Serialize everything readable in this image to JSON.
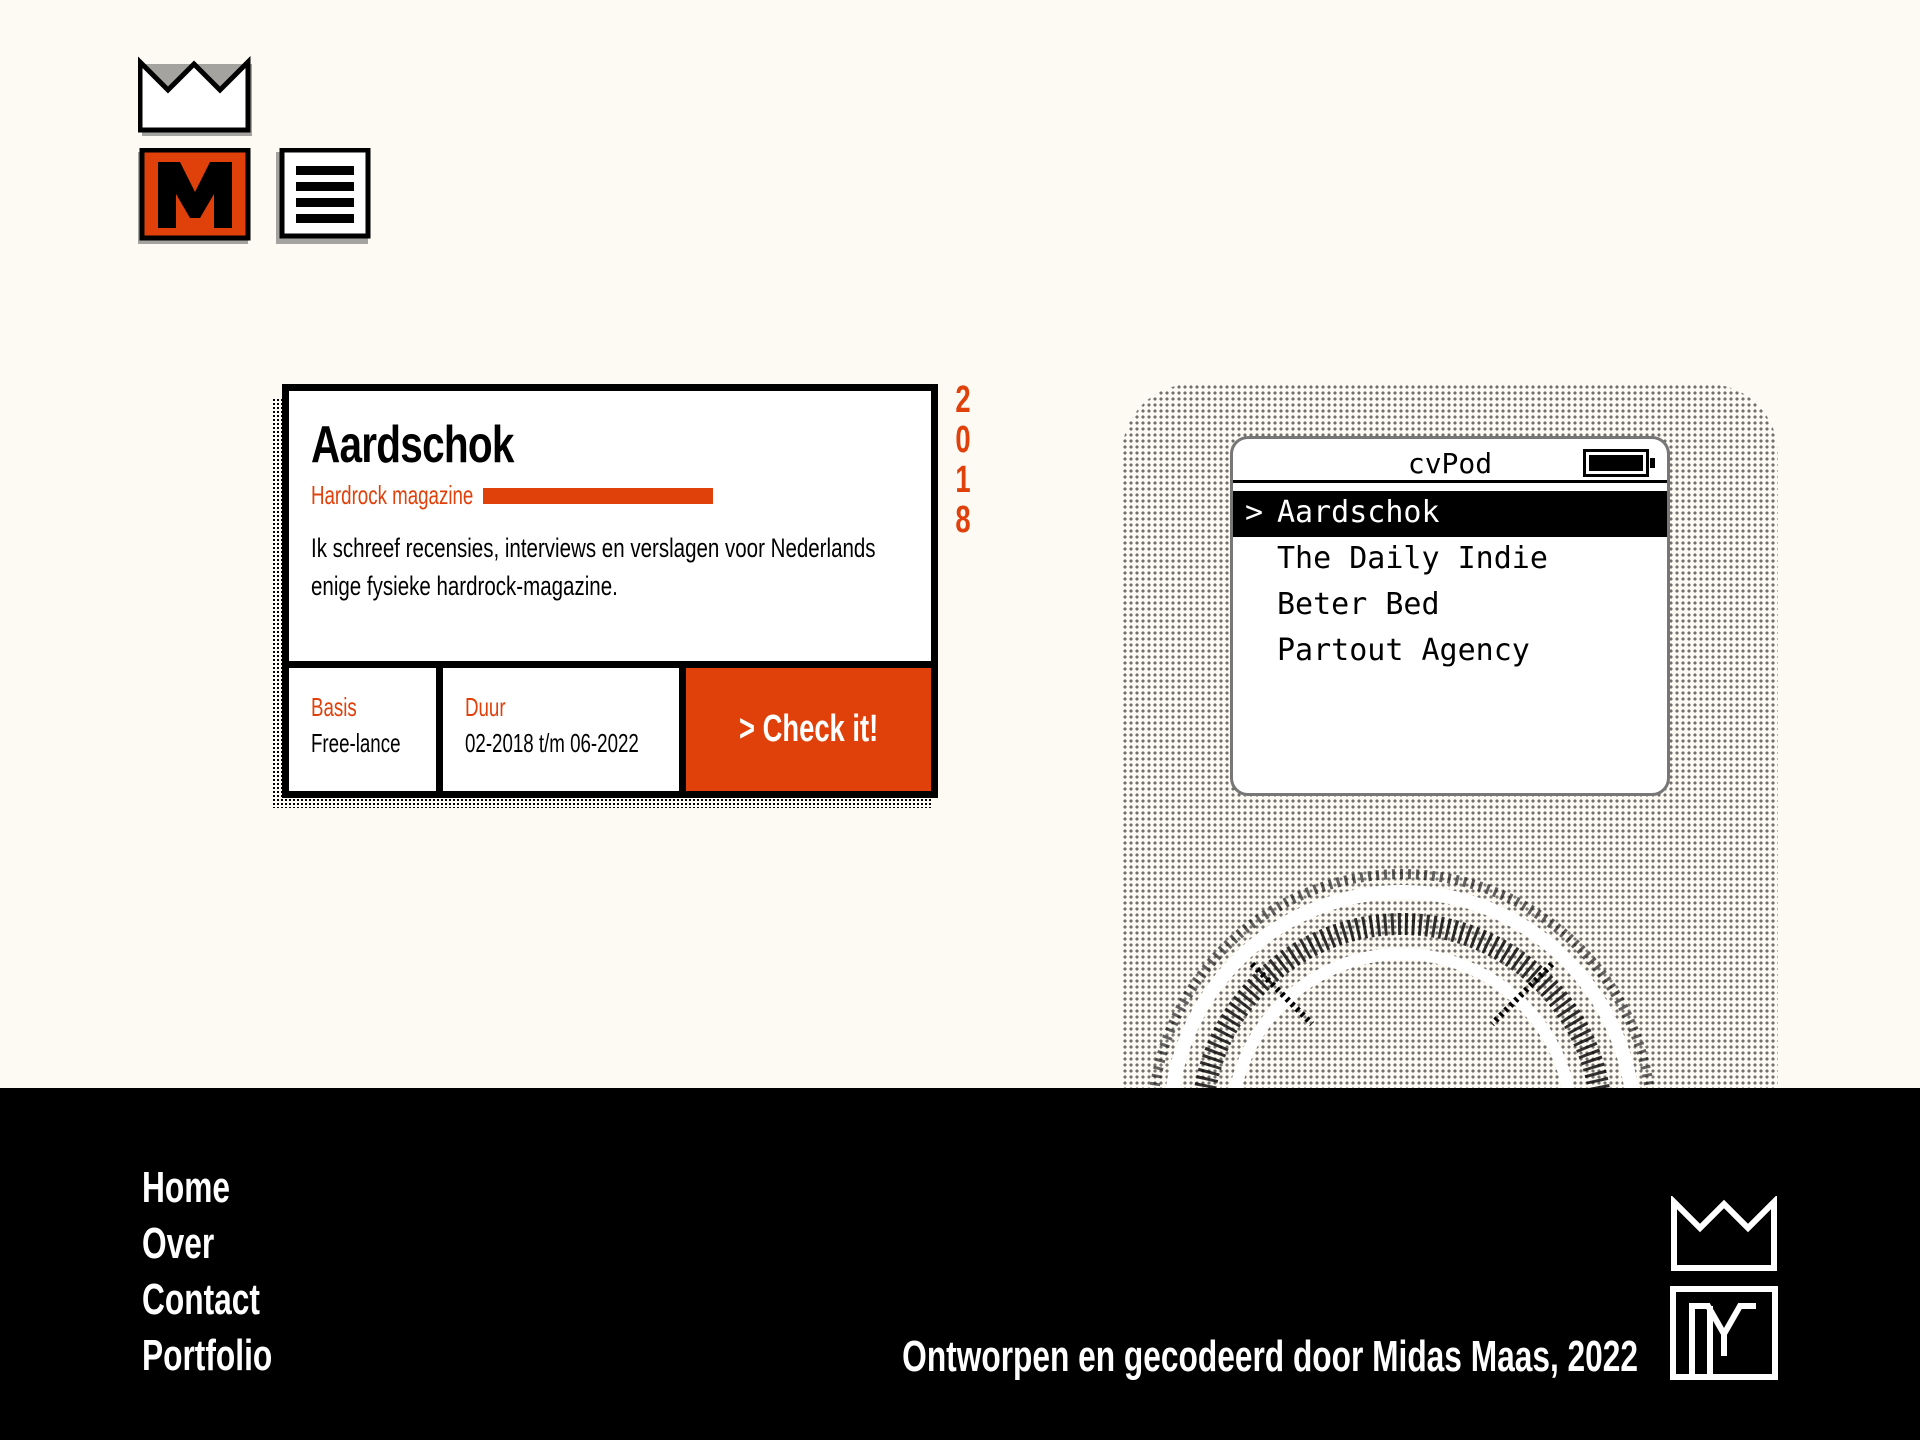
{
  "colors": {
    "accent": "#e0400a",
    "background": "#fdfaf4",
    "ink": "#000000",
    "footer": "#000000"
  },
  "header": {
    "logo_icon": "crown-m-logo-icon",
    "menu_icon": "hamburger-menu-icon"
  },
  "card": {
    "title": "Aardschok",
    "subtitle": "Hardrock magazine",
    "description": "Ik schreef recensies, interviews en verslagen voor Nederlands enige fysieke hardrock-magazine.",
    "year": [
      "2",
      "0",
      "1",
      "8"
    ],
    "basis_label": "Basis",
    "basis_value": "Free-lance",
    "duur_label": "Duur",
    "duur_value": "02-2018 t/m 06-2022",
    "cta_label": "> Check it!"
  },
  "cvpod": {
    "title": "cvPod",
    "battery_icon": "battery-full-icon",
    "items": [
      {
        "label": "Aardschok",
        "selected": true
      },
      {
        "label": "The Daily Indie",
        "selected": false
      },
      {
        "label": "Beter Bed",
        "selected": false
      },
      {
        "label": "Partout Agency",
        "selected": false
      }
    ],
    "selected_marker": ">"
  },
  "footer": {
    "nav": [
      "Home",
      "Over",
      "Contact",
      "Portfolio"
    ],
    "credit": "Ontworpen en gecodeerd door Midas Maas, 2022"
  }
}
